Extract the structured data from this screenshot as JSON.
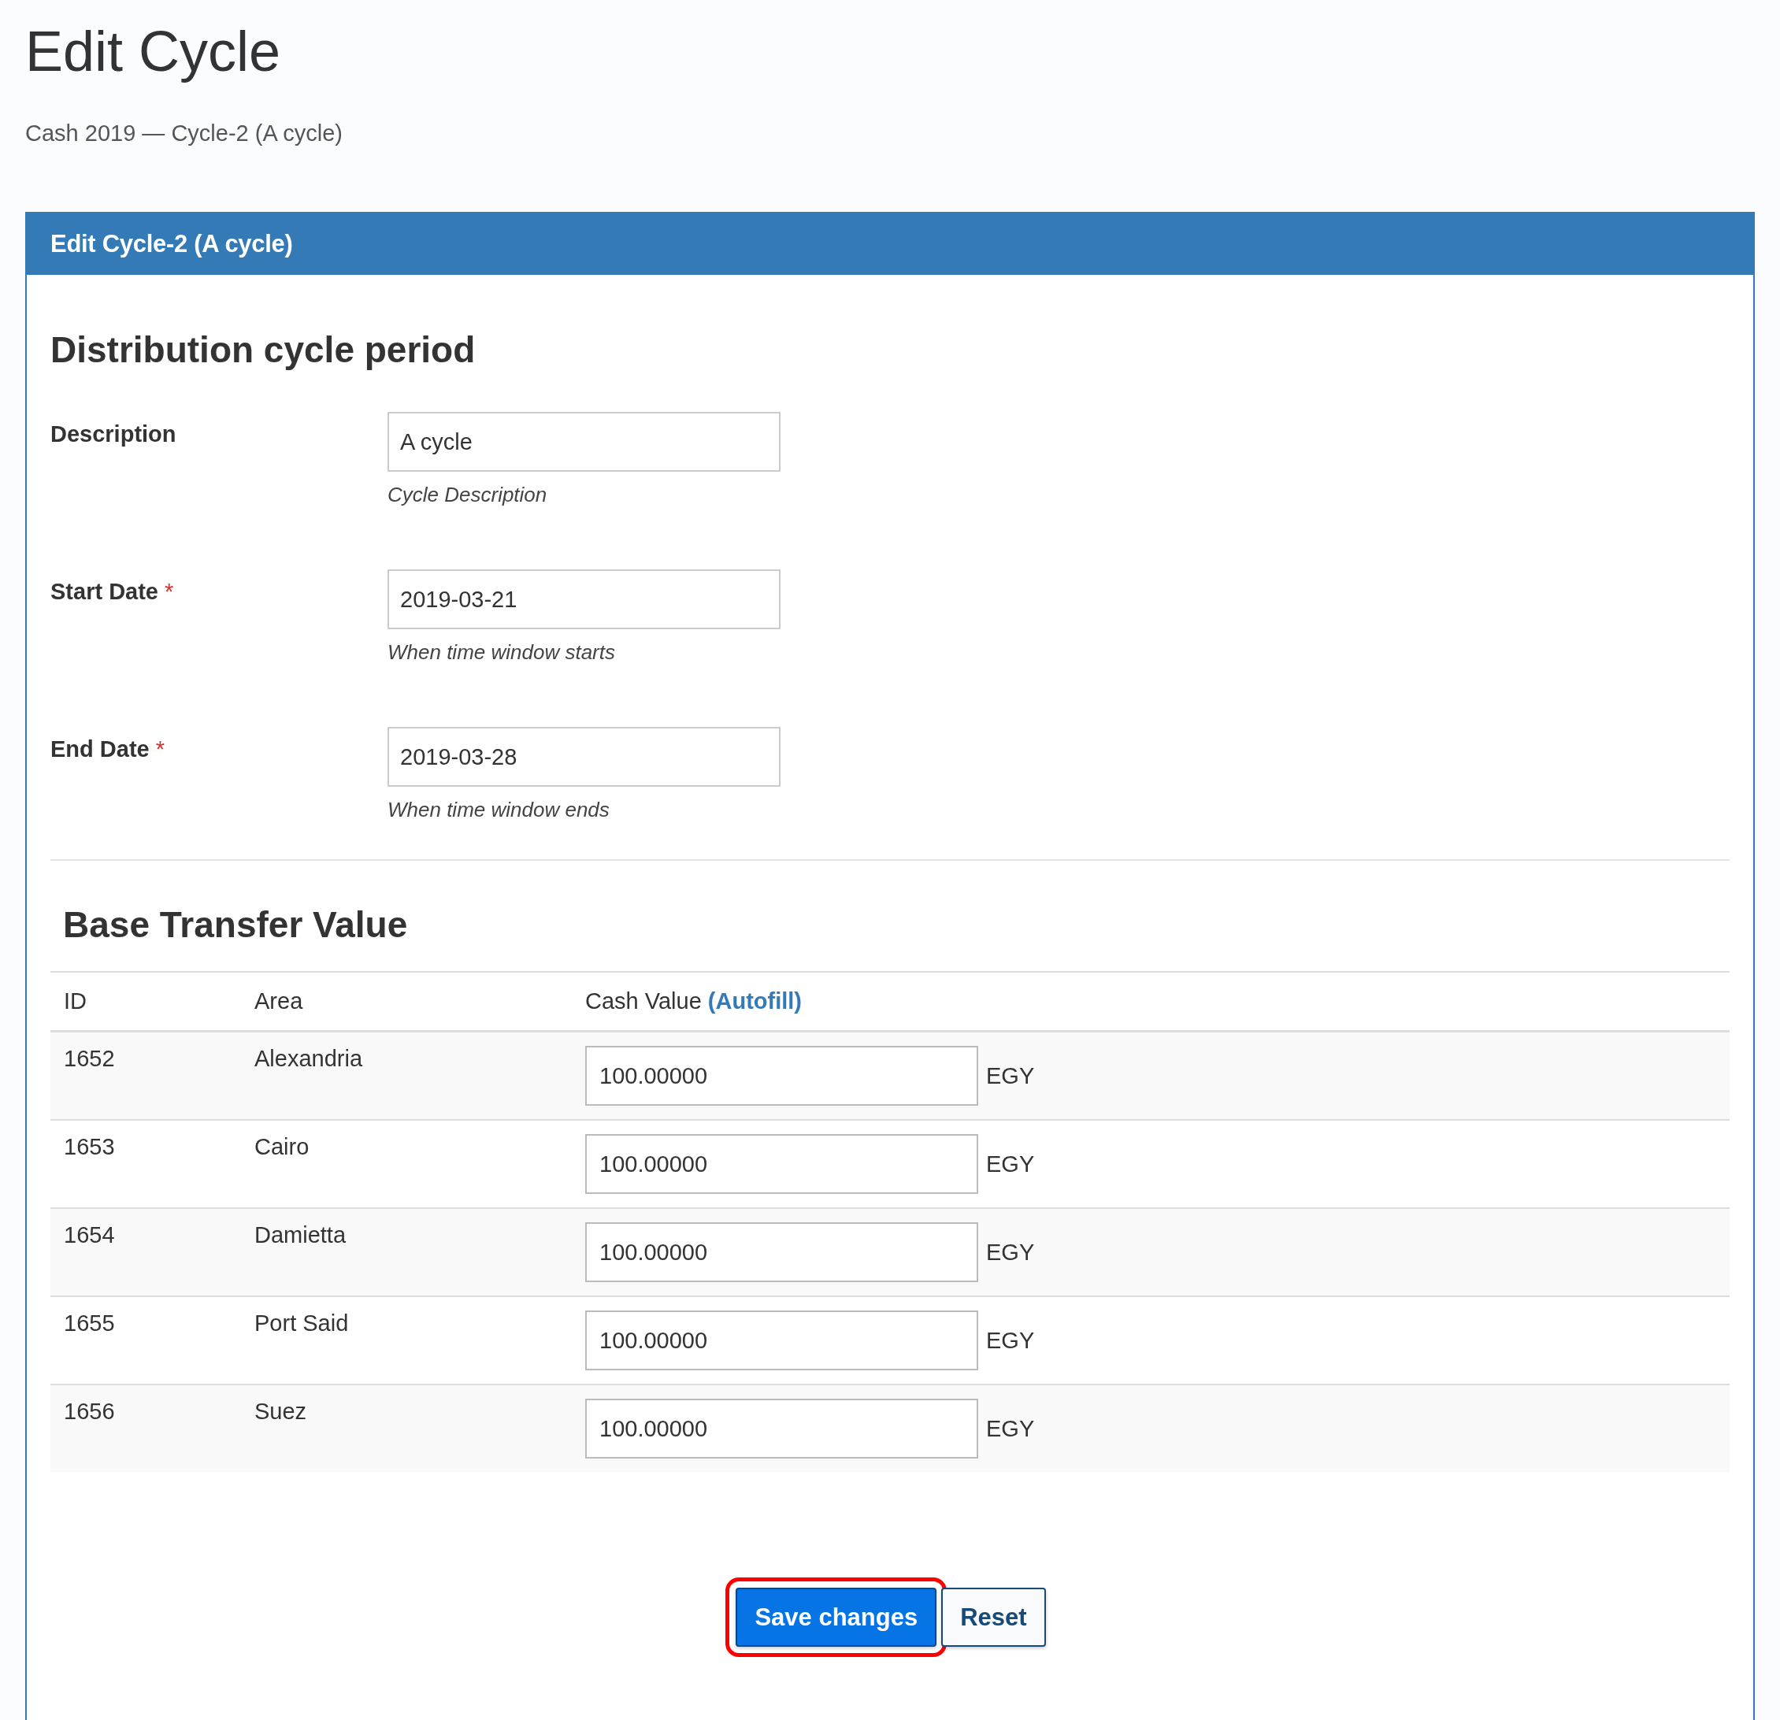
{
  "page": {
    "title": "Edit Cycle",
    "subtitle": "Cash 2019 — Cycle-2 (A cycle)"
  },
  "panel": {
    "title": "Edit Cycle-2 (A cycle)"
  },
  "period_section": {
    "heading": "Distribution cycle period",
    "fields": [
      {
        "label": "Description",
        "value": "A cycle",
        "help": "Cycle Description"
      },
      {
        "label": "Start Date",
        "required_mark": "*",
        "value": "2019-03-21",
        "help": "When time window starts"
      },
      {
        "label": "End Date",
        "required_mark": "*",
        "value": "2019-03-28",
        "help": "When time window ends"
      }
    ]
  },
  "transfer_section": {
    "heading": "Base Transfer Value",
    "table": {
      "columns": [
        "ID",
        "Area",
        "Cash Value"
      ],
      "autofill_link": "(Autofill)",
      "rows": [
        {
          "id": "1652",
          "area": "Alexandria",
          "value": "100.00000",
          "unit": "EGY"
        },
        {
          "id": "1653",
          "area": "Cairo",
          "value": "100.00000",
          "unit": "EGY"
        },
        {
          "id": "1654",
          "area": "Damietta",
          "value": "100.00000",
          "unit": "EGY"
        },
        {
          "id": "1655",
          "area": "Port Said",
          "value": "100.00000",
          "unit": "EGY"
        },
        {
          "id": "1656",
          "area": "Suez",
          "value": "100.00000",
          "unit": "EGY"
        }
      ]
    }
  },
  "buttons": [
    {
      "label": "Save changes",
      "kind": "primary",
      "highlighted": true
    },
    {
      "label": "Reset",
      "kind": "secondary",
      "highlighted": false
    }
  ]
}
